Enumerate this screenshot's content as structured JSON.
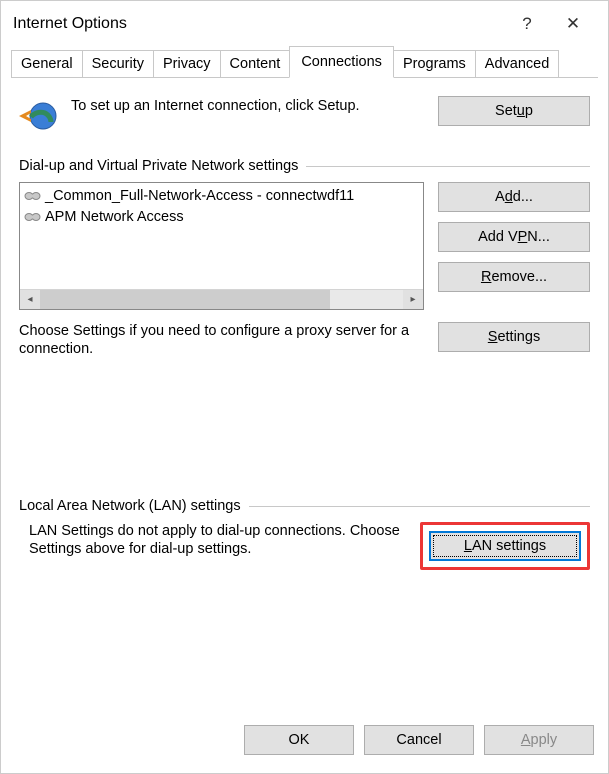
{
  "window": {
    "title": "Internet Options"
  },
  "tabs": [
    {
      "label": "General"
    },
    {
      "label": "Security"
    },
    {
      "label": "Privacy"
    },
    {
      "label": "Content"
    },
    {
      "label": "Connections"
    },
    {
      "label": "Programs"
    },
    {
      "label": "Advanced"
    }
  ],
  "active_tab_index": 4,
  "setup": {
    "text": "To set up an Internet connection, click Setup.",
    "button_html": "Set<u>u</u>p"
  },
  "dialup": {
    "group_label": "Dial-up and Virtual Private Network settings",
    "items": [
      "_Common_Full-Network-Access - connectwdf11",
      "APM Network Access"
    ],
    "buttons": {
      "add_html": "A<u>d</u>d...",
      "add_vpn_html": "Add V<u>P</u>N...",
      "remove_html": "<u>R</u>emove...",
      "settings_html": "<u>S</u>ettings"
    },
    "hint": "Choose Settings if you need to configure a proxy server for a connection."
  },
  "lan": {
    "group_label": "Local Area Network (LAN) settings",
    "hint": "LAN Settings do not apply to dial-up connections. Choose Settings above for dial-up settings.",
    "button_html": "<u>L</u>AN settings"
  },
  "footer": {
    "ok": "OK",
    "cancel": "Cancel",
    "apply_html": "<u>A</u>pply"
  }
}
